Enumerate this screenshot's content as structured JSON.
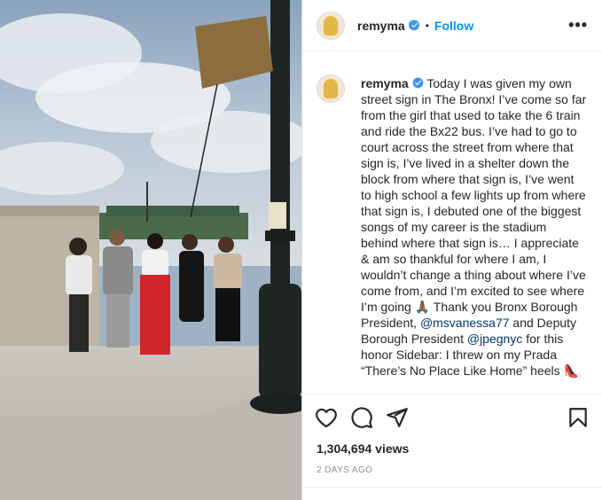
{
  "post": {
    "username": "remyma",
    "verified": true,
    "follow_label": "Follow",
    "separator": "•",
    "more_label": "•••",
    "caption": {
      "part1": "Today I was given my own street sign in The Bronx! I’ve come so far from the girl that used to take the 6 train and ride the Bx22 bus. I’ve had to go to court across the street from where that sign is, I’ve lived in a shelter down the block from where that sign is, I’ve went to high school a few lights up from where that sign is, I debuted one of the biggest songs of my career is the stadium behind where that sign is… I appreciate & am so thankful for where I am, I wouldn’t change a thing about where I’ve come from, and I’m excited to see where I’m going ",
      "emoji1": "🙏🏾",
      "part2": " Thank you Bronx Borough President, ",
      "mention1": "@msvanessa77",
      "part3": " and Deputy Borough President ",
      "mention2": "@jpegnyc",
      "part4": " for this honor Sidebar: I threw on my Prada “There’s No Place Like Home” heels ",
      "emoji2": "👠"
    },
    "views": "1,304,694 views",
    "posted_ago": "2 DAYS AGO"
  },
  "icons": {
    "like": "heart-icon",
    "comment": "comment-icon",
    "share": "send-icon",
    "save": "bookmark-icon",
    "verified": "verified-badge-icon",
    "more": "more-options-icon"
  },
  "colors": {
    "link_blue": "#0095f6",
    "mention": "#00376b",
    "verified_badge": "#3897f0",
    "meta_gray": "#8e8e8e"
  }
}
